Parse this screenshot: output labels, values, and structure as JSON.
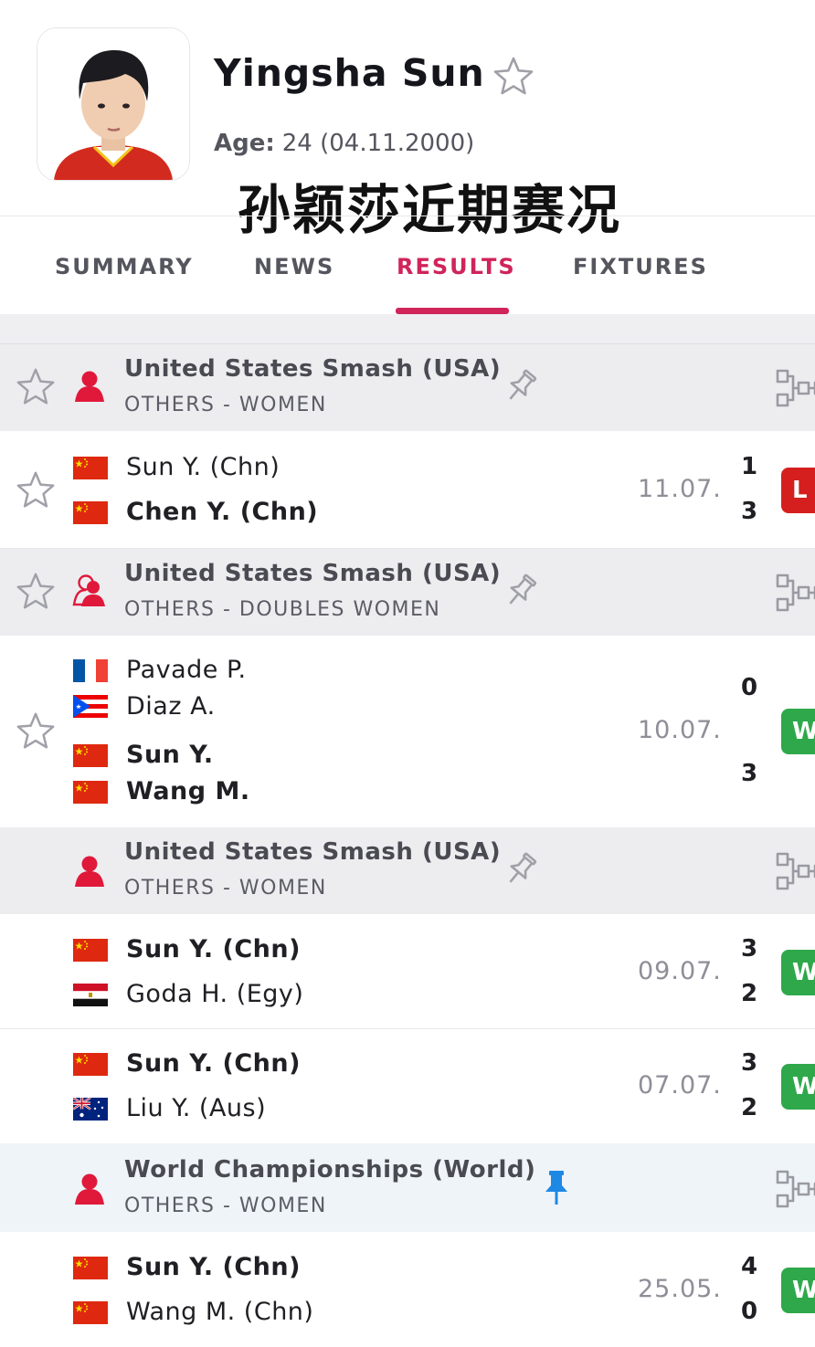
{
  "player": {
    "name": "Yingsha Sun",
    "age_label": "Age:",
    "age_value": "24 (04.11.2000)"
  },
  "overlay_caption": "孙颖莎近期赛况",
  "tabs": [
    {
      "label": "SUMMARY",
      "active": false
    },
    {
      "label": "NEWS",
      "active": false
    },
    {
      "label": "RESULTS",
      "active": true
    },
    {
      "label": "FIXTURES",
      "active": false
    }
  ],
  "colors": {
    "accent": "#d0245a",
    "win": "#2ea84a",
    "loss": "#d51f1f",
    "gender_icon": "#e0193a",
    "pin_active": "#1e88e5"
  },
  "results": [
    {
      "league": {
        "name": "United States Smash (USA)",
        "category": "OTHERS - WOMEN",
        "icon": "women-singles-icon",
        "pinned": false
      },
      "matches": [
        {
          "date": "11.07.",
          "outcome": "L",
          "home": {
            "players": [
              {
                "name": "Sun Y. (Chn)",
                "flag": "china-flag",
                "winner": false
              }
            ],
            "score": "1"
          },
          "away": {
            "players": [
              {
                "name": "Chen Y. (Chn)",
                "flag": "china-flag",
                "winner": true
              }
            ],
            "score": "3"
          }
        }
      ]
    },
    {
      "league": {
        "name": "United States Smash (USA)",
        "category": "OTHERS - DOUBLES WOMEN",
        "icon": "women-doubles-icon",
        "pinned": false
      },
      "matches": [
        {
          "date": "10.07.",
          "outcome": "W",
          "home": {
            "players": [
              {
                "name": "Pavade P.",
                "flag": "france-flag",
                "winner": false
              },
              {
                "name": "Diaz A.",
                "flag": "puerto-rico-flag",
                "winner": false
              }
            ],
            "score": "0"
          },
          "away": {
            "players": [
              {
                "name": "Sun Y.",
                "flag": "china-flag",
                "winner": true
              },
              {
                "name": "Wang M.",
                "flag": "china-flag",
                "winner": true
              }
            ],
            "score": "3"
          }
        }
      ]
    },
    {
      "league": {
        "name": "United States Smash (USA)",
        "category": "OTHERS - WOMEN",
        "icon": "women-singles-icon",
        "pinned": false
      },
      "matches": [
        {
          "date": "09.07.",
          "outcome": "W",
          "home": {
            "players": [
              {
                "name": "Sun Y. (Chn)",
                "flag": "china-flag",
                "winner": true
              }
            ],
            "score": "3"
          },
          "away": {
            "players": [
              {
                "name": "Goda H. (Egy)",
                "flag": "egypt-flag",
                "winner": false
              }
            ],
            "score": "2"
          }
        },
        {
          "date": "07.07.",
          "outcome": "W",
          "home": {
            "players": [
              {
                "name": "Sun Y. (Chn)",
                "flag": "china-flag",
                "winner": true
              }
            ],
            "score": "3"
          },
          "away": {
            "players": [
              {
                "name": "Liu Y. (Aus)",
                "flag": "australia-flag",
                "winner": false
              }
            ],
            "score": "2"
          }
        }
      ]
    },
    {
      "league": {
        "name": "World Championships (World)",
        "category": "OTHERS - WOMEN",
        "icon": "women-singles-icon",
        "pinned": true
      },
      "matches": [
        {
          "date": "25.05.",
          "outcome": "W",
          "home": {
            "players": [
              {
                "name": "Sun Y. (Chn)",
                "flag": "china-flag",
                "winner": true
              }
            ],
            "score": "4"
          },
          "away": {
            "players": [
              {
                "name": "Wang M. (Chn)",
                "flag": "china-flag",
                "winner": false
              }
            ],
            "score": "0"
          }
        }
      ]
    }
  ]
}
